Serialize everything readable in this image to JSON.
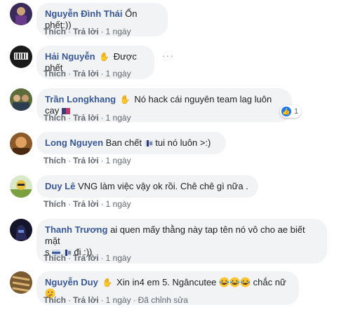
{
  "comments": [
    {
      "author": "Nguyễn Đình Thái",
      "text": "Ổn phết:))",
      "time": "1 ngày"
    },
    {
      "author": "Hải Nguyễn",
      "text": "Được phết",
      "time": "1 ngày"
    },
    {
      "author": "Trần Longkhang",
      "text": "Nó hack cái nguyên team lag luôn cay",
      "time": "1 ngày",
      "reaction_count": "1"
    },
    {
      "author": "Long Nguyen",
      "text_a": "Ban chết",
      "text_b": "tui nó luôn >:)",
      "time": "1 ngày"
    },
    {
      "author": "Duy Lê",
      "text": "VNG làm việc vậy ok rồi. Chê chê gì nữa .",
      "time": "1 ngày"
    },
    {
      "author": "Thanh Trương",
      "text_line1": "ai quen mấy thằng này tap tên nó vô cho ae biết mặt",
      "text_line2_a": "s",
      "text_line2_b": "đi :))",
      "time": "1 ngày"
    },
    {
      "author": "Nguyễn Duy",
      "text_a": "Xin in4 em 5. Ngâncutee",
      "text_b": "chắc nữ",
      "time": "1 ngày",
      "edited": "Đã chỉnh sửa"
    }
  ],
  "actions": {
    "like": "Thích",
    "reply": "Trả lời",
    "dot": "·"
  },
  "more_icon": "···",
  "colors": {
    "author": "#385898",
    "bubble": "#f2f3f5",
    "meta": "#606770",
    "like": "#1877f2"
  }
}
